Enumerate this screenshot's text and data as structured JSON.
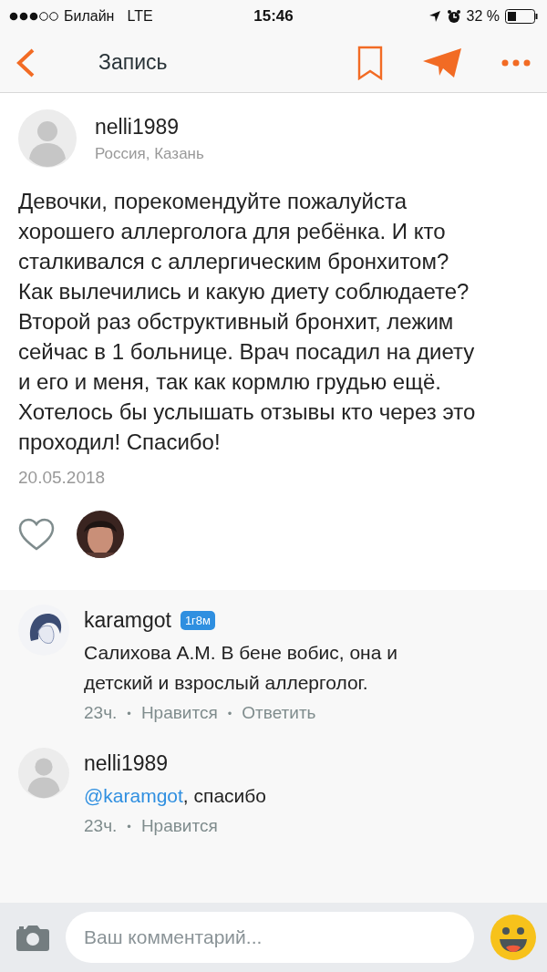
{
  "status_bar": {
    "carrier": "Билайн",
    "network": "LTE",
    "time": "15:46",
    "battery": "32 %"
  },
  "nav": {
    "title": "Запись"
  },
  "post": {
    "author": "nelli1989",
    "location": "Россия, Казань",
    "text": "Девочки, порекомендуйте пожалуйста хорошего аллерголога для ребёнка. И кто сталкивался с аллергическим бронхитом? Как вылечились и какую диету соблюдаете? Второй раз обструктивный бронхит, лежим сейчас в 1 больнице. Врач посадил на диету и его и меня, так как кормлю грудью ещё. Хотелось бы услышать отзывы кто через это проходил! Спасибо!",
    "date": "20.05.2018",
    "liked": false
  },
  "comments": [
    {
      "author": "karamgot",
      "badge": "1г8м",
      "kind": "drawing",
      "text": "Салихова А.М. В бене вобис, она и детский и взрослый аллерголог.",
      "meta": [
        {
          "kind": "time",
          "text": "23ч."
        },
        {
          "kind": "separator",
          "text": "•"
        },
        {
          "kind": "action",
          "text": "Нравится"
        },
        {
          "kind": "separator",
          "text": "•"
        },
        {
          "kind": "action",
          "text": "Ответить"
        }
      ]
    },
    {
      "author": "nelli1989",
      "kind": "placeholder",
      "mention": "@karamgot",
      "text": ", спасибо",
      "meta": [
        {
          "kind": "time",
          "text": "23ч."
        },
        {
          "kind": "separator",
          "text": "•"
        },
        {
          "kind": "action",
          "text": "Нравится"
        }
      ]
    }
  ],
  "composer": {
    "placeholder": "Ваш комментарий..."
  }
}
